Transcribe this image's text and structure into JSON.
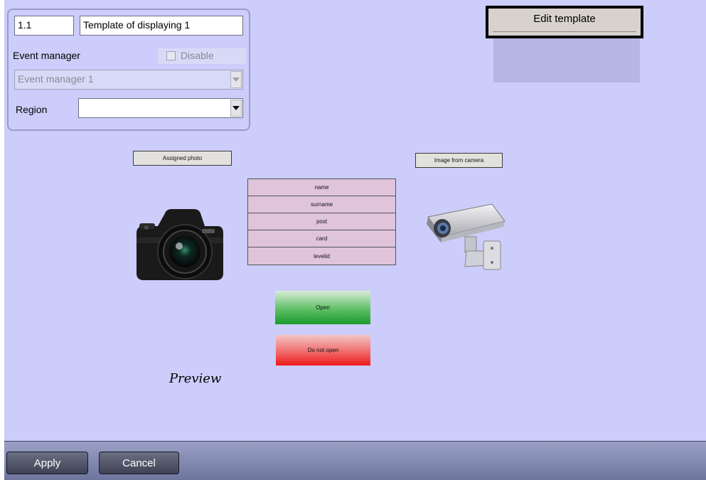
{
  "settings": {
    "id_value": "1.1",
    "name_value": "Template of displaying 1",
    "event_manager_label": "Event manager",
    "disable_label": "Disable",
    "disable_checked": false,
    "event_manager_select": "Event manager 1",
    "region_label": "Region",
    "region_select": ""
  },
  "toolbar": {
    "edit_template_label": "Edit template"
  },
  "preview": {
    "assigned_photo_label": "Assigned photo",
    "image_from_camera_label": "Image from camera",
    "fields": [
      "name",
      "surname",
      "post",
      "card",
      "levelid"
    ],
    "open_label": "Open",
    "do_not_open_label": "Do not open",
    "preview_caption": "Preview"
  },
  "icons": {
    "camera": "photo-camera-icon",
    "cctv": "cctv-camera-icon"
  },
  "footer": {
    "apply_label": "Apply",
    "cancel_label": "Cancel"
  },
  "colors": {
    "background": "#cccdfa",
    "open": "#1a9a2e",
    "do_not_open": "#ee1a1a",
    "field_bg": "#dfc4dc"
  }
}
